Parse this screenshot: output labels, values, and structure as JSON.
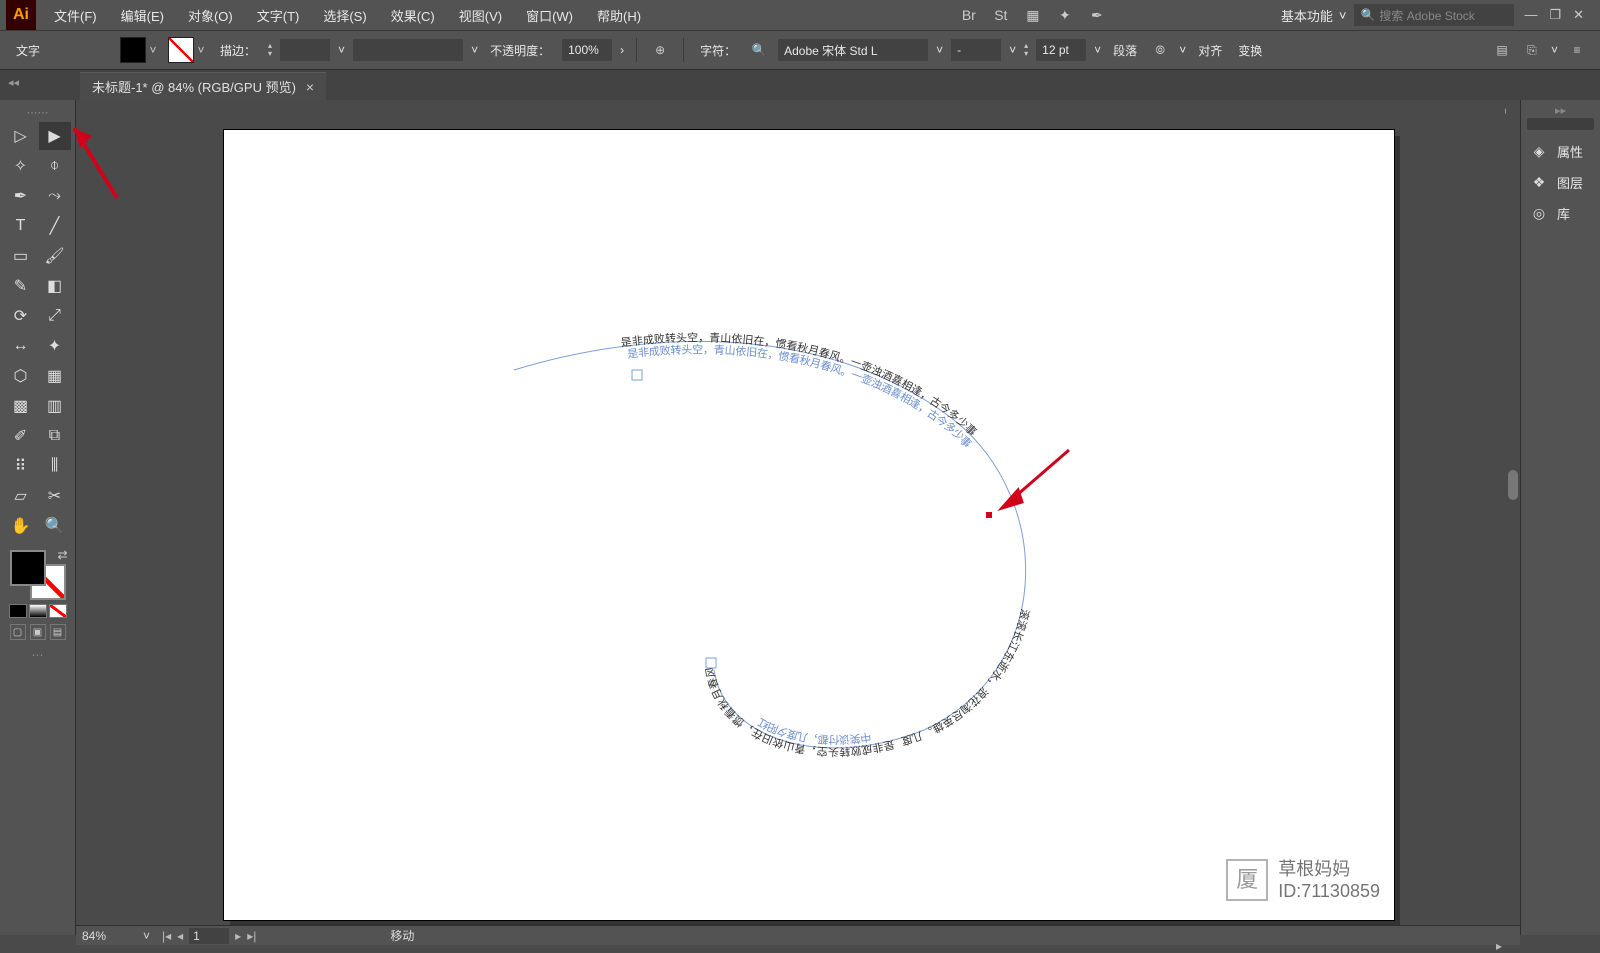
{
  "app": {
    "logo": "Ai"
  },
  "menu": {
    "items": [
      "文件(F)",
      "编辑(E)",
      "对象(O)",
      "文字(T)",
      "选择(S)",
      "效果(C)",
      "视图(V)",
      "窗口(W)",
      "帮助(H)"
    ],
    "workspace_label": "基本功能",
    "search_placeholder": "搜索 Adobe Stock"
  },
  "control": {
    "mode": "文字",
    "stroke_label": "描边：",
    "stroke_weight": "",
    "opacity_label": "不透明度：",
    "opacity_value": "100%",
    "char_label": "字符：",
    "font_name": "Adobe 宋体 Std L",
    "font_style": "-",
    "font_size": "12 pt",
    "paragraph_label": "段落",
    "align_label": "对齐",
    "transform_label": "变换"
  },
  "tab": {
    "title": "未标题-1* @ 84% (RGB/GPU 预览)"
  },
  "right": {
    "items": [
      {
        "icon": "◈",
        "label": "属性"
      },
      {
        "icon": "❖",
        "label": "图层"
      },
      {
        "icon": "◎",
        "label": "库"
      }
    ]
  },
  "status": {
    "zoom": "84%",
    "page": "1",
    "mode": "移动"
  },
  "watermark": {
    "name": "草根妈妈",
    "id": "ID:71130859"
  },
  "canvas": {
    "path_text_top": "是非成败转头空，青山依旧在，惯看秋月春风。一壶浊酒喜相逢，古今多少事",
    "path_text_right": "滚滚长江东逝水，浪花淘尽英雄。几度",
    "path_text_bottom": "是非成败转头空，青山依旧在，惯看秋月春风",
    "path_text_bottom2": "中笑谈付都，几度夕阳红"
  }
}
